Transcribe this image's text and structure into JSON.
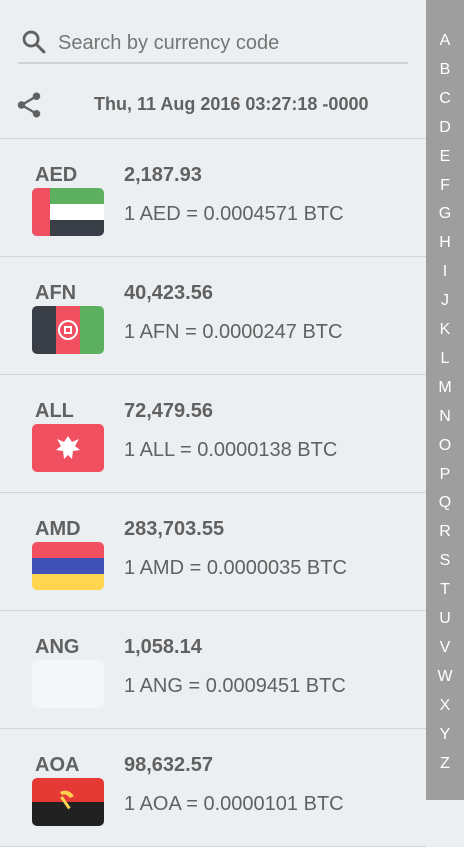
{
  "search": {
    "placeholder": "Search by currency code"
  },
  "header": {
    "timestamp": "Thu, 11 Aug 2016 03:27:18 -0000"
  },
  "currencies": [
    {
      "code": "AED",
      "value": "2,187.93",
      "rate": "1 AED = 0.0004571 BTC",
      "flag": "uae-flag-icon"
    },
    {
      "code": "AFN",
      "value": "40,423.56",
      "rate": "1 AFN = 0.0000247 BTC",
      "flag": "afghanistan-flag-icon"
    },
    {
      "code": "ALL",
      "value": "72,479.56",
      "rate": "1 ALL = 0.0000138 BTC",
      "flag": "albania-flag-icon"
    },
    {
      "code": "AMD",
      "value": "283,703.55",
      "rate": "1 AMD = 0.0000035 BTC",
      "flag": "armenia-flag-icon"
    },
    {
      "code": "ANG",
      "value": "1,058.14",
      "rate": "1 ANG = 0.0009451 BTC",
      "flag": "netherlands-antilles-flag-icon"
    },
    {
      "code": "AOA",
      "value": "98,632.57",
      "rate": "1 AOA = 0.0000101 BTC",
      "flag": "angola-flag-icon"
    }
  ],
  "index_letters": [
    "A",
    "B",
    "C",
    "D",
    "E",
    "F",
    "G",
    "H",
    "I",
    "J",
    "K",
    "L",
    "M",
    "N",
    "O",
    "P",
    "Q",
    "R",
    "S",
    "T",
    "U",
    "V",
    "W",
    "X",
    "Y",
    "Z"
  ],
  "colors": {
    "background": "#eceff1",
    "index_bar": "#9e9e9e",
    "text": "#616161",
    "flag_red": "#f05060",
    "flag_green": "#5cb060",
    "flag_dark": "#3a3f47",
    "flag_blue": "#3f51b5",
    "flag_yellow": "#ffd54f"
  }
}
